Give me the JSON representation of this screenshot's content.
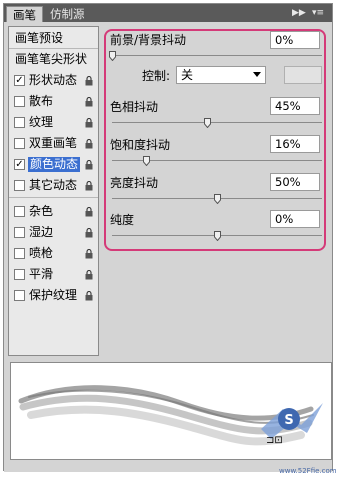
{
  "tabs": [
    {
      "label": "画笔"
    },
    {
      "label": "仿制源"
    }
  ],
  "tab_controls": {
    "collapse": "▶▶",
    "menu": "▾≡"
  },
  "left_list": {
    "title": "画笔预设",
    "items": [
      {
        "label": "画笔笔尖形状",
        "checkable": false,
        "checked": false,
        "locked": false,
        "selected": false
      },
      {
        "label": "形状动态",
        "checkable": true,
        "checked": true,
        "locked": true,
        "selected": false
      },
      {
        "label": "散布",
        "checkable": true,
        "checked": false,
        "locked": true,
        "selected": false
      },
      {
        "label": "纹理",
        "checkable": true,
        "checked": false,
        "locked": true,
        "selected": false
      },
      {
        "label": "双重画笔",
        "checkable": true,
        "checked": false,
        "locked": true,
        "selected": false
      },
      {
        "label": "颜色动态",
        "checkable": true,
        "checked": true,
        "locked": true,
        "selected": true
      },
      {
        "label": "其它动态",
        "checkable": true,
        "checked": false,
        "locked": true,
        "selected": false
      },
      {
        "label": "杂色",
        "checkable": true,
        "checked": false,
        "locked": true,
        "selected": false
      },
      {
        "label": "湿边",
        "checkable": true,
        "checked": false,
        "locked": true,
        "selected": false
      },
      {
        "label": "喷枪",
        "checkable": true,
        "checked": false,
        "locked": true,
        "selected": false
      },
      {
        "label": "平滑",
        "checkable": true,
        "checked": false,
        "locked": true,
        "selected": false
      },
      {
        "label": "保护纹理",
        "checkable": true,
        "checked": false,
        "locked": true,
        "selected": false
      }
    ]
  },
  "settings": {
    "fg_bg_jitter": {
      "label": "前景/背景抖动",
      "value": "0%",
      "level": 0
    },
    "control": {
      "label": "控制:",
      "selected": "关"
    },
    "hue_jitter": {
      "label": "色相抖动",
      "value": "45%",
      "level": 45
    },
    "saturation_jitter": {
      "label": "饱和度抖动",
      "value": "16%",
      "level": 16
    },
    "brightness_jitter": {
      "label": "亮度抖动",
      "value": "50%",
      "level": 50
    },
    "purity": {
      "label": "纯度",
      "value": "0%",
      "level": 50
    }
  },
  "watermark": {
    "text": "www.52Ffie.com"
  },
  "colors": {
    "accent_pink": "#d43a78",
    "selection_blue": "#3b6fd0"
  }
}
